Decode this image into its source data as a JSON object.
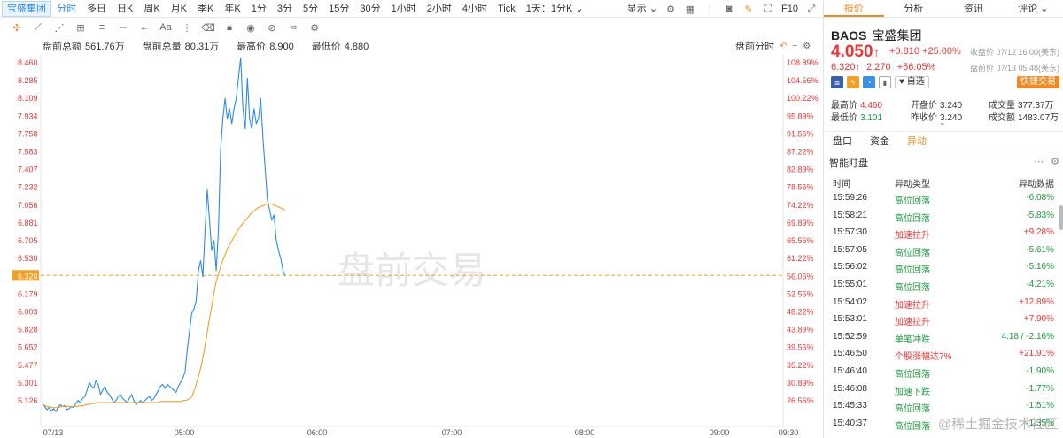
{
  "topbar": {
    "stock_tab": "宝盛集团",
    "tabs": [
      "分时",
      "多日",
      "日K",
      "周K",
      "月K",
      "季K",
      "年K",
      "1分",
      "3分",
      "5分",
      "15分",
      "30分",
      "1小时",
      "2小时",
      "4小时",
      "Tick",
      "1天：1分K"
    ],
    "active_tab": "分时",
    "display_label": "显示",
    "f10_label": "F10"
  },
  "stats": {
    "pre_total_amount_label": "盘前总额",
    "pre_total_amount": "561.76万",
    "pre_total_volume_label": "盘前总量",
    "pre_total_volume": "80.31万",
    "high_label": "最高价",
    "high": "8.900",
    "low_label": "最低价",
    "low": "4.880",
    "mode": "盘前分时"
  },
  "chart_data": {
    "type": "line",
    "watermark": "盘前交易",
    "y_left_ticks": [
      "8.460",
      "8.285",
      "8.109",
      "7.934",
      "7.758",
      "7.583",
      "7.407",
      "7.232",
      "7.056",
      "6.881",
      "6.705",
      "6.530",
      "6.320",
      "6.179",
      "6.003",
      "5.828",
      "5.652",
      "5.477",
      "5.301",
      "5.126"
    ],
    "y_right_ticks": [
      "108.89%",
      "104.56%",
      "100.22%",
      "95.89%",
      "91.56%",
      "87.22%",
      "82.89%",
      "78.56%",
      "74.22%",
      "69.89%",
      "65.56%",
      "61.22%",
      "56.05%",
      "52.56%",
      "48.22%",
      "43.89%",
      "39.56%",
      "35.22%",
      "30.89%",
      "26.56%"
    ],
    "x_ticks": [
      "07/13",
      "05:00",
      "06:00",
      "07:00",
      "08:00",
      "09:00",
      "09:30"
    ],
    "ylim": [
      5.02,
      8.52
    ],
    "reference_price": 6.32,
    "series": [
      {
        "color": "#2a8ce6",
        "values": [
          5.09,
          5.06,
          5.03,
          5.05,
          5.02,
          5.04,
          5.01,
          5.05,
          5.08,
          5.06,
          5.07,
          5.03,
          5.04,
          5.06,
          5.05,
          5.09,
          5.12,
          5.1,
          5.14,
          5.16,
          5.22,
          5.3,
          5.26,
          5.24,
          5.32,
          5.28,
          5.18,
          5.22,
          5.26,
          5.2,
          5.18,
          5.14,
          5.1,
          5.12,
          5.16,
          5.18,
          5.14,
          5.12,
          5.1,
          5.14,
          5.18,
          5.12,
          5.08,
          5.1,
          5.12,
          5.1,
          5.12,
          5.14,
          5.16,
          5.12,
          5.14,
          5.18,
          5.22,
          5.26,
          5.28,
          5.24,
          5.28,
          5.26,
          5.24,
          5.22,
          5.2,
          5.26,
          5.3,
          5.34,
          5.4,
          5.62,
          5.8,
          5.98,
          6.02,
          6.1,
          6.4,
          6.5,
          6.34,
          6.8,
          7.2,
          6.9,
          6.6,
          6.7,
          6.4,
          6.8,
          7.6,
          7.9,
          8.1,
          7.9,
          8.0,
          7.85,
          8.0,
          8.1,
          8.3,
          8.5,
          8.0,
          7.8,
          8.3,
          7.9,
          7.8,
          8.0,
          7.85,
          7.9,
          8.1,
          7.7,
          7.4,
          7.1,
          7.0,
          6.9,
          6.95,
          6.7,
          6.6,
          6.52,
          6.4,
          6.35
        ],
        "points_legend": "price"
      },
      {
        "color": "#f2a027",
        "values": [
          5.08,
          5.07,
          5.06,
          5.06,
          5.05,
          5.05,
          5.05,
          5.05,
          5.06,
          5.06,
          5.06,
          5.06,
          5.06,
          5.06,
          5.06,
          5.06,
          5.07,
          5.07,
          5.07,
          5.08,
          5.08,
          5.09,
          5.09,
          5.09,
          5.1,
          5.1,
          5.1,
          5.1,
          5.1,
          5.1,
          5.1,
          5.1,
          5.1,
          5.1,
          5.1,
          5.1,
          5.1,
          5.1,
          5.1,
          5.1,
          5.1,
          5.1,
          5.1,
          5.1,
          5.1,
          5.1,
          5.1,
          5.1,
          5.1,
          5.1,
          5.1,
          5.11,
          5.11,
          5.11,
          5.11,
          5.11,
          5.11,
          5.11,
          5.11,
          5.11,
          5.11,
          5.12,
          5.12,
          5.13,
          5.14,
          5.18,
          5.24,
          5.32,
          5.4,
          5.5,
          5.62,
          5.76,
          5.9,
          6.02,
          6.16,
          6.28,
          6.36,
          6.44,
          6.5,
          6.56,
          6.62,
          6.66,
          6.7,
          6.74,
          6.78,
          6.82,
          6.85,
          6.88,
          6.9,
          6.93,
          6.96,
          6.98,
          7.0,
          7.02,
          7.03,
          7.04,
          7.05,
          7.06,
          7.06,
          7.06,
          7.05,
          7.04,
          7.03,
          7.02,
          7.01,
          7.0
        ]
      }
    ]
  },
  "panel": {
    "tabs": [
      "报价",
      "分析",
      "资讯",
      "评论"
    ],
    "active_tab": "报价",
    "ticker": "BAOS",
    "name": "宝盛集团",
    "price": "4.050",
    "price_arrow": "↑",
    "change": "+0.810",
    "change_pct": "+25.00%",
    "close_time": "收盘价 07/12 16:00(美东)",
    "pre_price": "6.320",
    "pre_arrow": "↑",
    "pre_change": "2.270",
    "pre_change_pct": "+56.05%",
    "pre_time": "盘前价 07/13 05:48(美东)",
    "fav_label": "自选",
    "quick_trade": "快捷交易",
    "high_label": "最高价",
    "high": "4.460",
    "low_label": "最低价",
    "low": "3.101",
    "open_label": "开盘价",
    "open": "3.240",
    "prev_close_label": "昨收价",
    "prev_close": "3.240",
    "vol_label": "成交量",
    "vol": "377.37万",
    "amount_label": "成交额",
    "amount": "1483.07万",
    "subtabs": [
      "盘口",
      "资金",
      "异动"
    ],
    "active_subtab": "异动",
    "smart_title": "智能盯盘",
    "col_time": "时间",
    "col_type": "异动类型",
    "col_data": "异动数据",
    "rows": [
      {
        "time": "15:59:26",
        "type": "高位回落",
        "data": "-6.08%",
        "kind": "green"
      },
      {
        "time": "15:58:21",
        "type": "高位回落",
        "data": "-5.83%",
        "kind": "green"
      },
      {
        "time": "15:57:30",
        "type": "加速拉升",
        "data": "+9.28%",
        "kind": "red"
      },
      {
        "time": "15:57:05",
        "type": "高位回落",
        "data": "-5.61%",
        "kind": "green"
      },
      {
        "time": "15:56:02",
        "type": "高位回落",
        "data": "-5.16%",
        "kind": "green"
      },
      {
        "time": "15:55:01",
        "type": "高位回落",
        "data": "-4.21%",
        "kind": "green"
      },
      {
        "time": "15:54:02",
        "type": "加速拉升",
        "data": "+12.89%",
        "kind": "red"
      },
      {
        "time": "15:53:01",
        "type": "加速拉升",
        "data": "+7.90%",
        "kind": "red"
      },
      {
        "time": "15:52:59",
        "type": "单笔冲跌",
        "data": "4.18 / -2.16%",
        "kind": "green"
      },
      {
        "time": "15:46:50",
        "type": "个股涨幅达7%",
        "data": "+21.91%",
        "kind": "red"
      },
      {
        "time": "15:46:40",
        "type": "高位回落",
        "data": "-1.90%",
        "kind": "green"
      },
      {
        "time": "15:46:08",
        "type": "加速下跌",
        "data": "-1.77%",
        "kind": "green"
      },
      {
        "time": "15:45:33",
        "type": "高位回落",
        "data": "-1.51%",
        "kind": "green"
      },
      {
        "time": "15:40:37",
        "type": "高位回落",
        "data": "-1.35%",
        "kind": "green"
      }
    ],
    "watermark": "@稀土掘金技术社区"
  },
  "colors": {
    "up": "#e33333",
    "down": "#1a9c3b",
    "accent": "#f08a24",
    "blue": "#2a8ce6"
  }
}
